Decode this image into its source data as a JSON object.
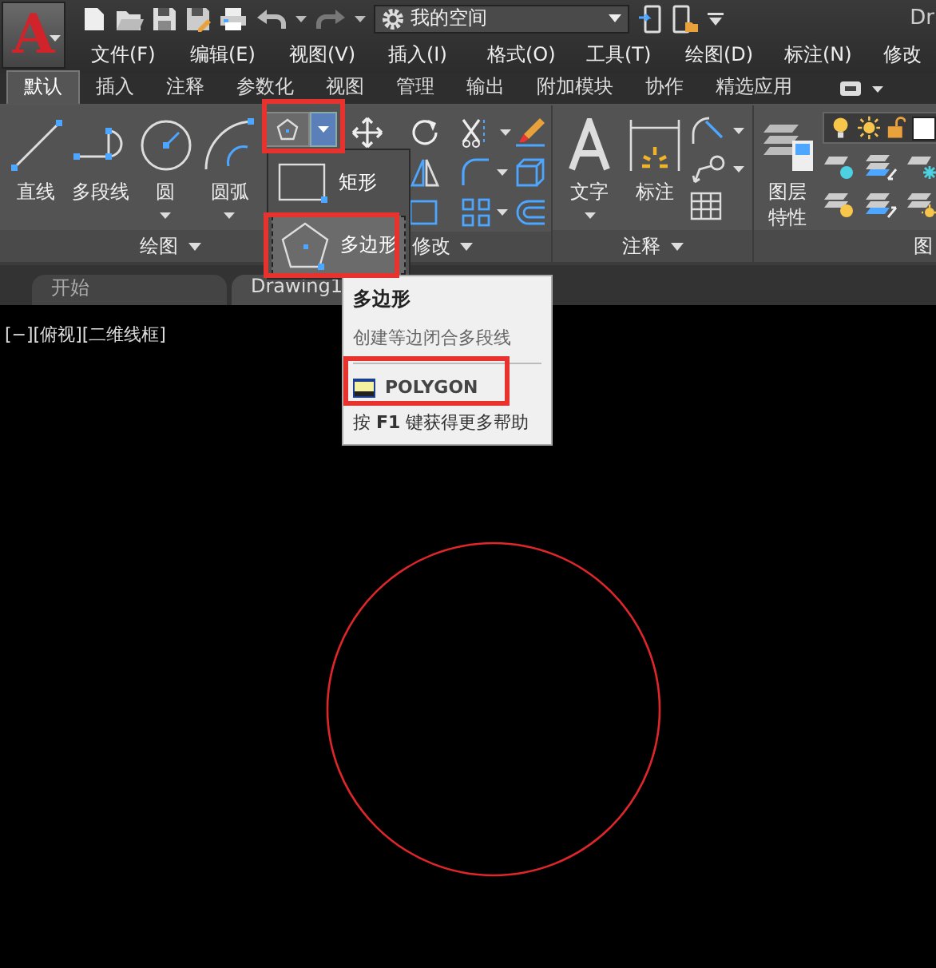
{
  "title_bar": {
    "logo": "A",
    "workspace": "我的空间",
    "title": "Dr"
  },
  "menu": [
    "文件(F)",
    "编辑(E)",
    "视图(V)",
    "插入(I)",
    "格式(O)",
    "工具(T)",
    "绘图(D)",
    "标注(N)",
    "修改"
  ],
  "ribbon_tabs": [
    {
      "label": "默认",
      "selected": true
    },
    {
      "label": "插入",
      "selected": false
    },
    {
      "label": "注释",
      "selected": false
    },
    {
      "label": "参数化",
      "selected": false
    },
    {
      "label": "视图",
      "selected": false
    },
    {
      "label": "管理",
      "selected": false
    },
    {
      "label": "输出",
      "selected": false
    },
    {
      "label": "附加模块",
      "selected": false
    },
    {
      "label": "协作",
      "selected": false
    },
    {
      "label": "精选应用",
      "selected": false
    }
  ],
  "draw_panel": {
    "title": "绘图",
    "tools": [
      {
        "label": "直线",
        "kind": "line"
      },
      {
        "label": "多段线",
        "kind": "polyline"
      },
      {
        "label": "圆",
        "kind": "circle"
      },
      {
        "label": "圆弧",
        "kind": "arc"
      }
    ]
  },
  "modify_panel": {
    "title": "修改"
  },
  "annotation_panel": {
    "title": "注释",
    "tools": [
      {
        "label": "文字",
        "kind": "text"
      },
      {
        "label": "标注",
        "kind": "dimension"
      }
    ]
  },
  "layers_panel": {
    "title": "图",
    "tool": "图层特性"
  },
  "flyout": [
    {
      "label": "矩形",
      "kind": "rectangle",
      "selected": false
    },
    {
      "label": "多边形",
      "kind": "polygon",
      "selected": true
    }
  ],
  "doc_tabs": [
    {
      "label": "开始",
      "selected": false
    },
    {
      "label": "Drawing1",
      "selected": true
    }
  ],
  "viewport_label": "[−][俯视][二维线框]",
  "tooltip": {
    "title": "多边形",
    "description": "创建等边闭合多段线",
    "command": "POLYGON",
    "help": "按 **F1** 键获得更多帮助"
  }
}
